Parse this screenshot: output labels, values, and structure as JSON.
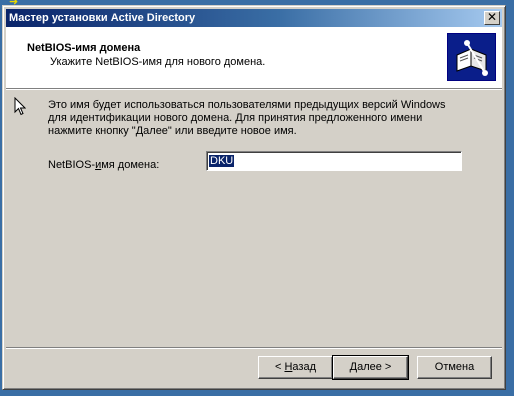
{
  "window": {
    "title": "Мастер установки Active Directory",
    "close_glyph": "✕"
  },
  "header": {
    "title": "NetBIOS-имя домена",
    "subtitle": "Укажите NetBIOS-имя для нового домена.",
    "icon": "book-network-icon"
  },
  "body": {
    "lines": [
      "Это имя будет использоваться пользователями предыдущих версий Windows",
      "для идентификации нового домена. Для принятия предложенного имени",
      "нажмите кнопку \"Далее\" или введите новое имя."
    ]
  },
  "field": {
    "label_before": "NetBIOS-",
    "label_underlined": "и",
    "label_after": "мя домена:",
    "value": "DKU"
  },
  "buttons": {
    "back_prefix": "< ",
    "back_underlined": "Н",
    "back_rest": "азад",
    "next_underlined": "Д",
    "next_rest": "алее >",
    "cancel": "Отмена"
  },
  "colors": {
    "titlebar_start": "#0a246a",
    "titlebar_end": "#a6caf0",
    "dialog_face": "#d4d0c8",
    "desktop": "#3a6ea5",
    "selection": "#0a246a"
  }
}
